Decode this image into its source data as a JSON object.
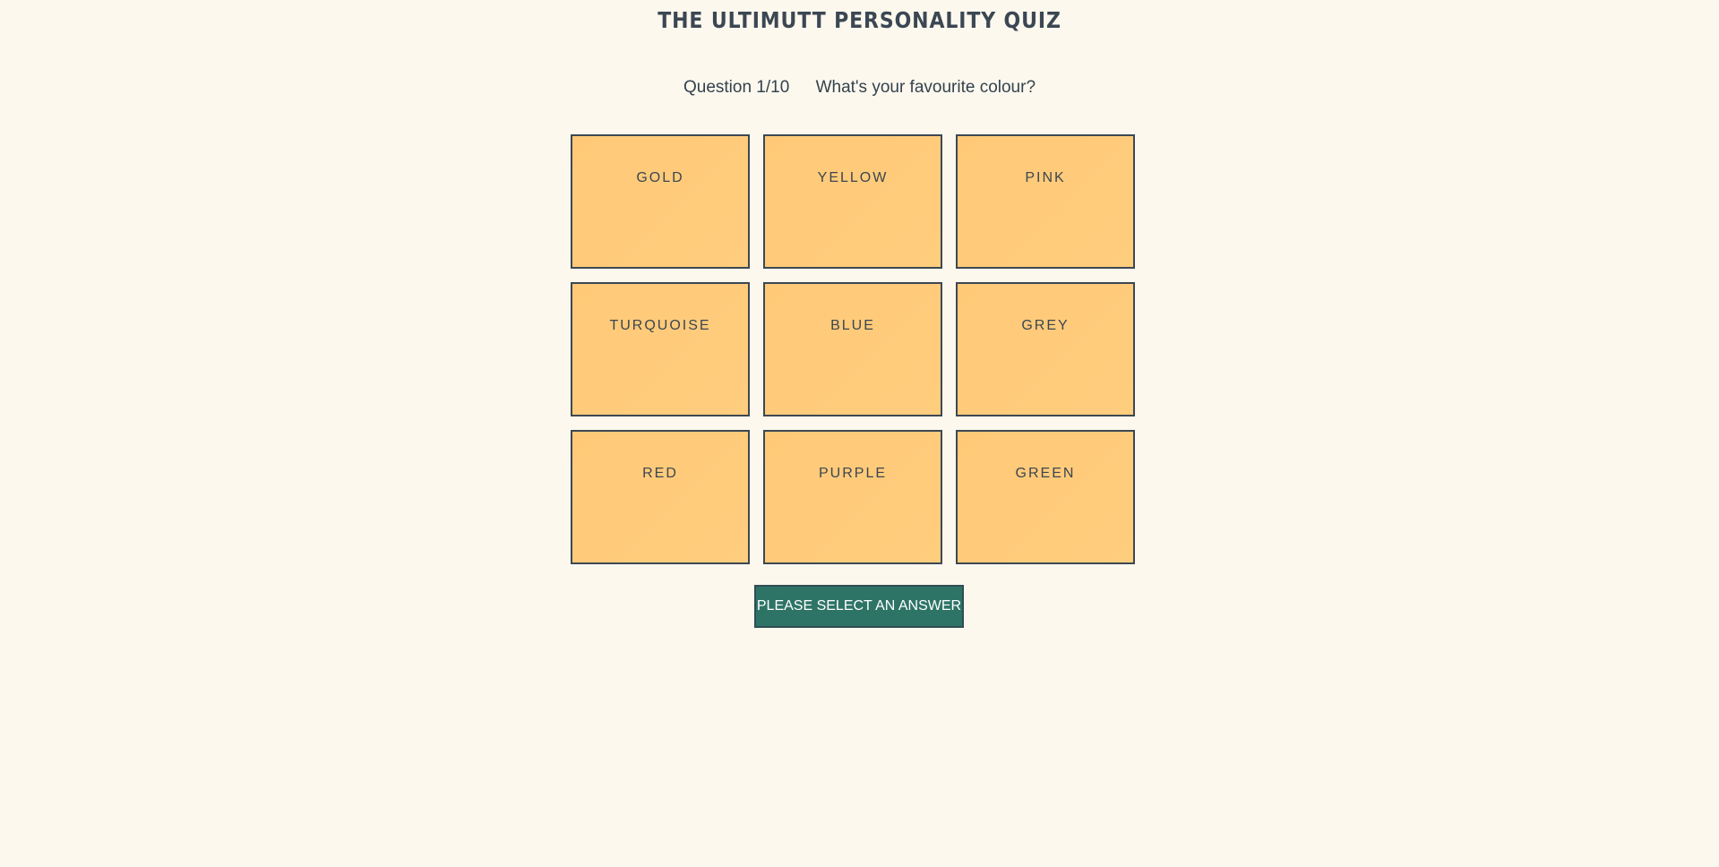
{
  "header": {
    "title": "THE ULTIMUTT PERSONALITY QUIZ"
  },
  "question": {
    "number": "Question 1/10",
    "text": "What's your favourite colour?"
  },
  "answers": [
    {
      "label": "GOLD"
    },
    {
      "label": "YELLOW"
    },
    {
      "label": "PINK"
    },
    {
      "label": "TURQUOISE"
    },
    {
      "label": "BLUE"
    },
    {
      "label": "GREY"
    },
    {
      "label": "RED"
    },
    {
      "label": "PURPLE"
    },
    {
      "label": "GREEN"
    }
  ],
  "submit": {
    "label": "PLEASE SELECT AN ANSWER"
  },
  "colors": {
    "background": "#fdf8ee",
    "tile": "#ffca7a",
    "button": "#2e7466",
    "text": "#33424d"
  }
}
